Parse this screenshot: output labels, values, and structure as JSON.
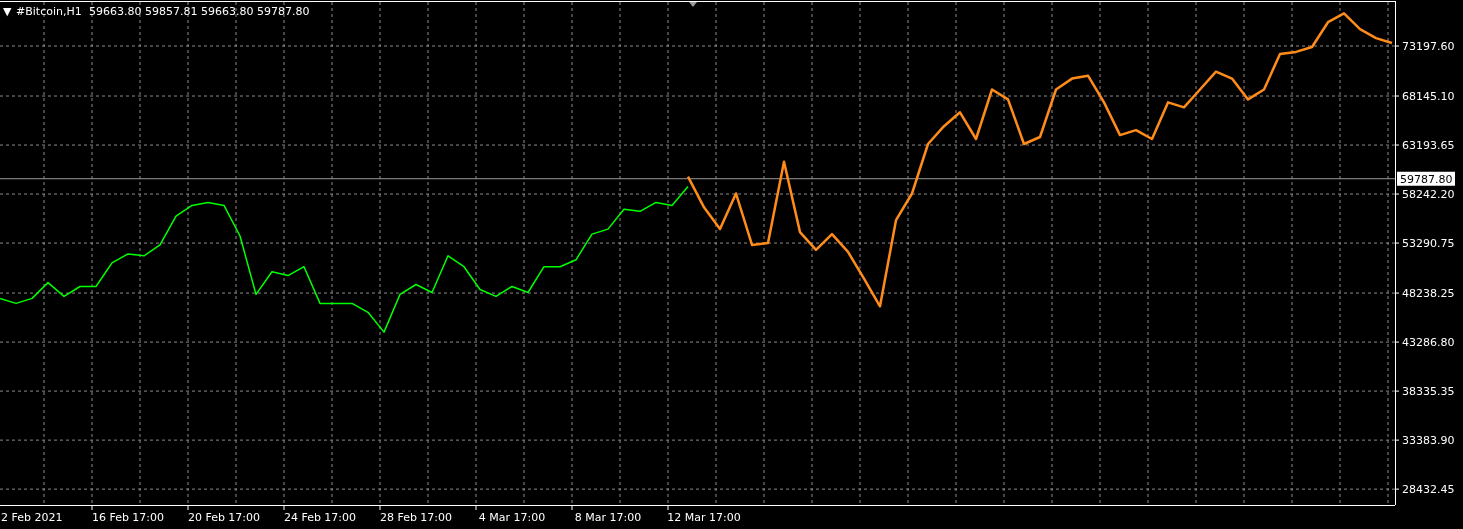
{
  "header": {
    "menu_symbol": "▼",
    "symbol": "#Bitcoin,H1",
    "quotes": [
      "59663.80",
      "59857.81",
      "59663.80",
      "59787.80"
    ]
  },
  "chart_data": {
    "type": "line",
    "grid": true,
    "categories": [
      null,
      null,
      "2 Feb 2021",
      null,
      null,
      null,
      null,
      null,
      "16 Feb 17:00",
      null,
      null,
      null,
      null,
      null,
      "20 Feb 17:00",
      null,
      null,
      null,
      null,
      null,
      "24 Feb 17:00",
      null,
      null,
      null,
      null,
      null,
      "28 Feb 17:00",
      null,
      null,
      null,
      null,
      null,
      "4 Mar 17:00",
      null,
      null,
      null,
      null,
      null,
      "8 Mar 17:00",
      null,
      null,
      null,
      null,
      null,
      "12 Mar 17:00",
      null,
      null,
      null,
      null,
      null,
      null,
      null,
      null,
      null,
      null,
      null,
      null,
      null,
      null,
      null,
      null,
      null,
      null,
      null,
      null,
      null,
      null,
      null,
      null,
      null,
      null,
      null,
      null,
      null,
      null,
      null,
      null,
      null,
      null,
      null,
      null,
      null,
      null,
      null,
      null,
      null,
      null,
      null
    ],
    "series": [
      {
        "color": "#00ff00",
        "values": [
          47700,
          47200,
          47700,
          49300,
          47900,
          48900,
          48900,
          51300,
          52200,
          52000,
          53100,
          56000,
          57100,
          57400,
          57100,
          54000,
          48100,
          50400,
          50000,
          50900,
          47200,
          47200,
          47200,
          46300,
          44300,
          48100,
          49100,
          48300,
          52000,
          50900,
          48600,
          47900,
          48900,
          48300,
          50900,
          50900,
          51600,
          54200,
          54700,
          56700,
          56500,
          57400,
          57100,
          59000,
          null,
          null,
          null,
          null,
          null,
          null,
          null,
          null,
          null,
          null,
          null,
          null,
          null,
          null,
          null,
          null,
          null,
          null,
          null,
          null,
          null,
          null,
          null,
          null,
          null,
          null,
          null,
          null,
          null,
          null,
          null,
          null,
          null,
          null,
          null,
          null,
          null,
          null,
          null,
          null,
          null,
          null,
          null,
          null
        ]
      },
      {
        "color": "#ff8c1a",
        "values": [
          null,
          null,
          null,
          null,
          null,
          null,
          null,
          null,
          null,
          null,
          null,
          null,
          null,
          null,
          null,
          null,
          null,
          null,
          null,
          null,
          null,
          null,
          null,
          null,
          null,
          null,
          null,
          null,
          null,
          null,
          null,
          null,
          null,
          null,
          null,
          null,
          null,
          null,
          null,
          null,
          null,
          null,
          null,
          60000,
          56900,
          54700,
          58300,
          53100,
          53300,
          61500,
          54400,
          52600,
          54200,
          52400,
          49700,
          46900,
          55600,
          58300,
          63300,
          65100,
          66500,
          63800,
          68800,
          67800,
          63300,
          64000,
          68800,
          69900,
          70200,
          67500,
          64200,
          64700,
          63800,
          67500,
          67000,
          68800,
          70600,
          69900,
          67800,
          68800,
          72400,
          72600,
          73100,
          75600,
          76500,
          74900,
          74000,
          73500
        ]
      }
    ],
    "ref_lines": [
      {
        "axis": "y",
        "value": 59787.8,
        "label": "59787.80"
      }
    ],
    "ylim": [
      26829,
      77845
    ],
    "yticks": [
      {
        "value": 73197.6,
        "label": "73197.60"
      },
      {
        "value": 68145.1,
        "label": "68145.10"
      },
      {
        "value": 63193.65,
        "label": "63193.65"
      },
      {
        "value": 58242.2,
        "label": "58242.20"
      },
      {
        "value": 53290.75,
        "label": "53290.75"
      },
      {
        "value": 48238.25,
        "label": "48238.25"
      },
      {
        "value": 43286.8,
        "label": "43286.80"
      },
      {
        "value": 38335.35,
        "label": "38335.35"
      },
      {
        "value": 33383.9,
        "label": "33383.90"
      },
      {
        "value": 28432.45,
        "label": "28432.45"
      }
    ]
  }
}
